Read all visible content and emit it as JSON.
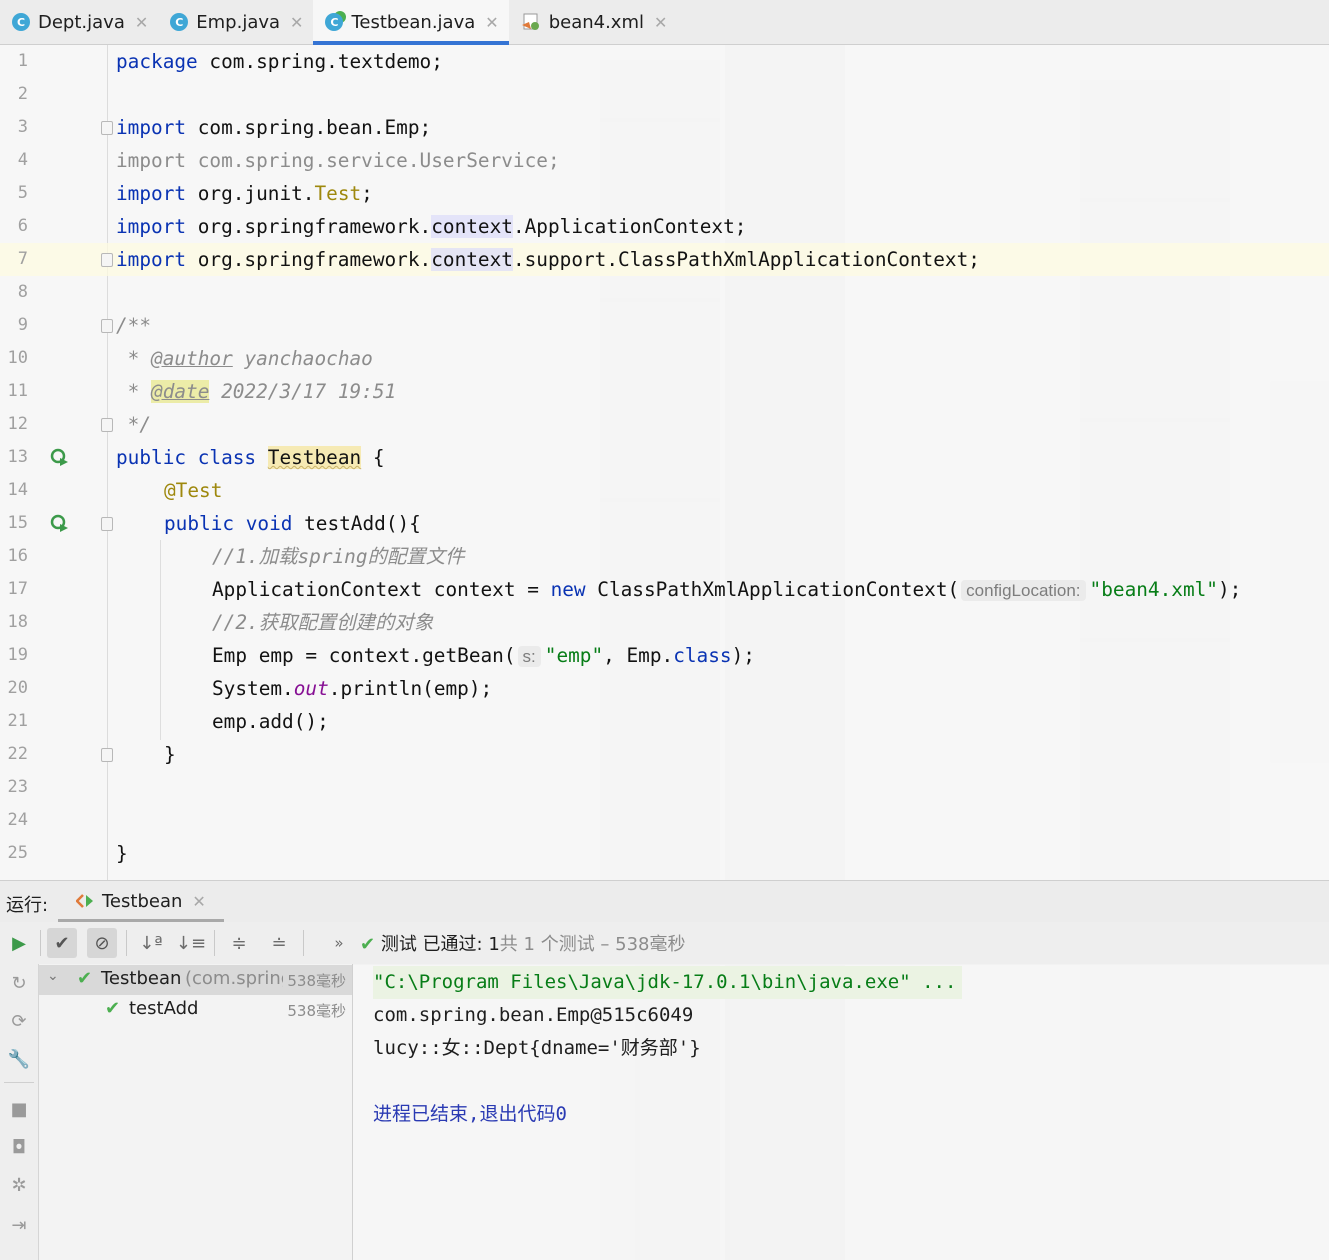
{
  "tabs": [
    {
      "label": "Dept.java",
      "icon": "java-class-icon",
      "active": false
    },
    {
      "label": "Emp.java",
      "icon": "java-class-icon",
      "active": false
    },
    {
      "label": "Testbean.java",
      "icon": "java-test-class-icon",
      "active": true
    },
    {
      "label": "bean4.xml",
      "icon": "xml-file-icon",
      "active": false
    }
  ],
  "editor": {
    "current_line": 7,
    "line_numbers": [
      "1",
      "2",
      "3",
      "4",
      "5",
      "6",
      "7",
      "8",
      "9",
      "10",
      "11",
      "12",
      "13",
      "14",
      "15",
      "16",
      "17",
      "18",
      "19",
      "20",
      "21",
      "22",
      "23",
      "24",
      "25"
    ],
    "code": {
      "l1_kw": "package",
      "l1_rest": " com.spring.textdemo;",
      "l3_kw": "import",
      "l3_rest": " com.spring.bean.Emp;",
      "l4": "import com.spring.service.UserService;",
      "l5_kw": "import",
      "l5_a": " org.junit.",
      "l5_b": "Test",
      "l5_c": ";",
      "l6_kw": "import",
      "l6_a": " org.springframework.",
      "l6_b": "context",
      "l6_c": ".ApplicationContext;",
      "l7_kw": "import",
      "l7_a": " org.springframework.",
      "l7_b": "context",
      "l7_c": ".support.ClassPathXmlApplicationContext;",
      "l9": "/**",
      "l10_a": " * ",
      "l10_tag": "@author",
      "l10_b": " yanchaochao",
      "l11_a": " * ",
      "l11_tag": "@date",
      "l11_b": " 2022/3/17 19:51",
      "l12": " */",
      "l13_kw": "public class",
      "l13_cls": "Testbean",
      "l13_b": " {",
      "l14": "@Test",
      "l15_kw": "public void",
      "l15_b": " testAdd(){",
      "l16": "//1.加载spring的配置文件",
      "l17_a": "ApplicationContext context = ",
      "l17_kw": "new",
      "l17_b": " ClassPathXmlApplicationContext(",
      "l17_hint": "configLocation:",
      "l17_str": "\"bean4.xml\"",
      "l17_c": ");",
      "l18": "//2.获取配置创建的对象",
      "l19_a": "Emp emp = context.getBean(",
      "l19_hint": "s:",
      "l19_str": "\"emp\"",
      "l19_b": ", Emp.",
      "l19_kw": "class",
      "l19_c": ");",
      "l20_a": "System.",
      "l20_out": "out",
      "l20_b": ".println(emp);",
      "l21": "emp.add();",
      "l22": "}",
      "l25": "}"
    }
  },
  "run_panel": {
    "label": "运行:",
    "tab": "Testbean",
    "status_check": "✔",
    "status_main": "测试 已通过: 1",
    "status_dim": "共 1 个测试 – 538毫秒",
    "tree": [
      {
        "name": "Testbean",
        "detail": "(com.spring",
        "time": "538毫秒"
      },
      {
        "name": "testAdd",
        "time": "538毫秒"
      }
    ],
    "console": [
      "\"C:\\Program Files\\Java\\jdk-17.0.1\\bin\\java.exe\" ...",
      "com.spring.bean.Emp@515c6049",
      "lucy::女::Dept{dname='财务部'}",
      "",
      "进程已结束,退出代码0"
    ]
  },
  "colors": {
    "accent": "#3574d4",
    "keyword": "#0a33b3",
    "string": "#077d17",
    "annotation": "#9e880d",
    "pass": "#4caf50"
  }
}
